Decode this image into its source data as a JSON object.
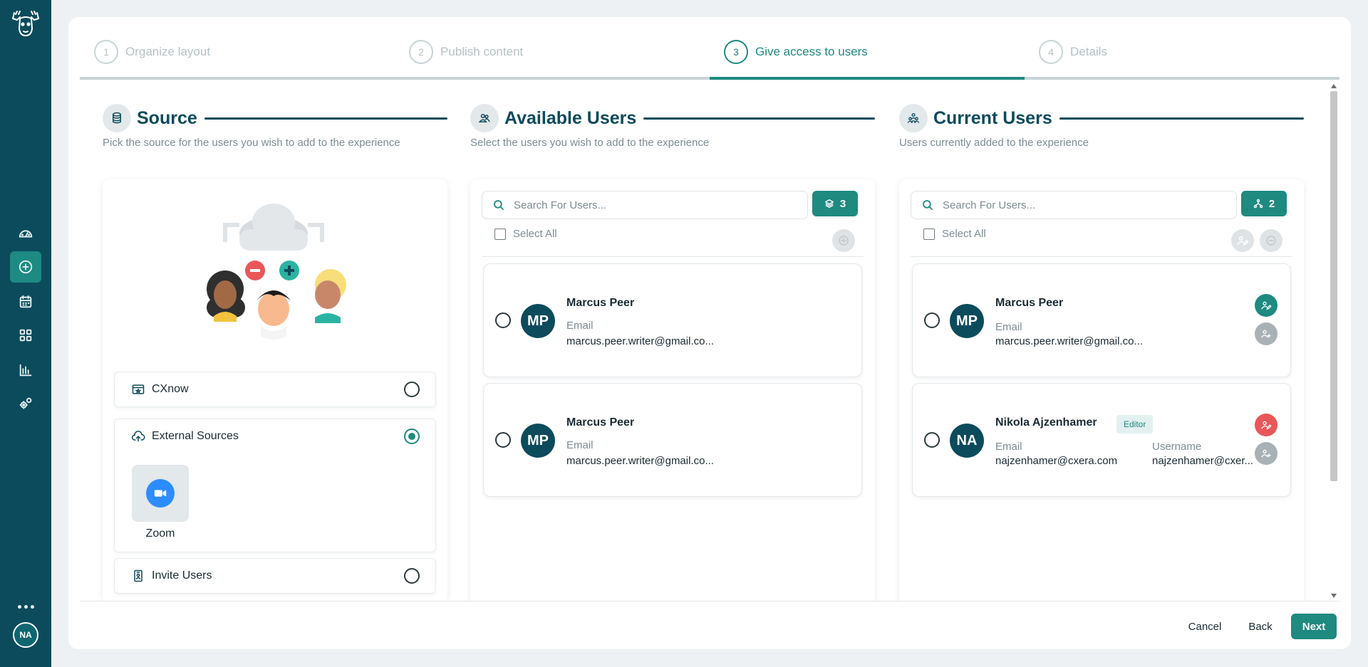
{
  "sidebar": {
    "items": [
      {
        "icon": "dashboard-icon",
        "active": false
      },
      {
        "icon": "add-circle-icon",
        "active": true
      },
      {
        "icon": "calendar-icon",
        "active": false
      },
      {
        "icon": "grid-icon",
        "active": false
      },
      {
        "icon": "bar-chart-icon",
        "active": false
      },
      {
        "icon": "settings-gears-icon",
        "active": false
      }
    ],
    "user_initials": "NA"
  },
  "stepper": {
    "steps": [
      {
        "number": "1",
        "label": "Organize layout"
      },
      {
        "number": "2",
        "label": "Publish content"
      },
      {
        "number": "3",
        "label": "Give access to users"
      },
      {
        "number": "4",
        "label": "Details"
      }
    ],
    "active_index": 2
  },
  "source": {
    "title": "Source",
    "subtitle": "Pick the source for the users you wish to add to the experience",
    "options": [
      {
        "label": "CXnow",
        "selected": false
      },
      {
        "label": "External Sources",
        "selected": true
      },
      {
        "label": "Invite Users",
        "selected": false
      }
    ],
    "external_items": [
      {
        "label": "Zoom"
      }
    ]
  },
  "available": {
    "title": "Available Users",
    "subtitle": "Select the users you wish to add to the experience",
    "search_placeholder": "Search For Users...",
    "count": "3",
    "select_all_label": "Select All",
    "users": [
      {
        "initials": "MP",
        "name": "Marcus Peer",
        "email_label": "Email",
        "email": "marcus.peer.writer@gmail.co..."
      },
      {
        "initials": "MP",
        "name": "Marcus Peer",
        "email_label": "Email",
        "email": "marcus.peer.writer@gmail.co..."
      }
    ]
  },
  "current": {
    "title": "Current Users",
    "subtitle": "Users currently added to the experience",
    "search_placeholder": "Search For Users...",
    "count": "2",
    "select_all_label": "Select All",
    "users": [
      {
        "initials": "MP",
        "name": "Marcus Peer",
        "email_label": "Email",
        "email": "marcus.peer.writer@gmail.co..."
      },
      {
        "initials": "NA",
        "name": "Nikola Ajzenhamer",
        "role": "Editor",
        "email_label": "Email",
        "email": "najzenhamer@cxera.com",
        "username_label": "Username",
        "username": "najzenhamer@cxer..."
      }
    ]
  },
  "footer": {
    "cancel": "Cancel",
    "back": "Back",
    "next": "Next"
  },
  "colors": {
    "sidebar": "#0c4b5c",
    "accent": "#1e8a80",
    "danger": "#e9575a",
    "muted": "#b5c1c5"
  }
}
